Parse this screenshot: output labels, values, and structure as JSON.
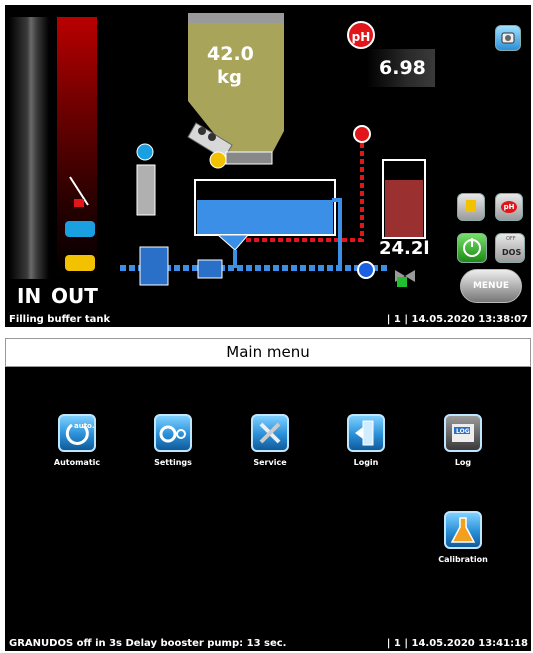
{
  "screen1": {
    "in_label": "IN",
    "out_label": "OUT",
    "hopper_value": "42.0",
    "hopper_unit": "kg",
    "ph_badge": "pH",
    "ph_value": "6.98",
    "tank_volume": "24.2l",
    "dos_button_label": "DOS",
    "dos_off_label": "OFF",
    "menu_button_label": "MENUE",
    "ph_button_label": "pH",
    "status": {
      "message": "Filling buffer tank",
      "right": "| 1 | 14.05.2020 13:38:07"
    }
  },
  "screen2": {
    "title": "Main menu",
    "items": [
      {
        "label": "Automatic",
        "icon": "auto-refresh-icon"
      },
      {
        "label": "Settings",
        "icon": "gears-icon"
      },
      {
        "label": "Service",
        "icon": "tools-icon"
      },
      {
        "label": "Login",
        "icon": "door-icon"
      },
      {
        "label": "Log",
        "icon": "log-book-icon"
      },
      {
        "label": "Calibration",
        "icon": "flask-icon"
      }
    ],
    "auto_icon_text": "auto.",
    "log_icon_text": "LOG",
    "status": {
      "message": "GRANUDOS off in 3s Delay booster pump: 13 sec.",
      "right": "| 1 | 14.05.2020 13:41:18"
    }
  },
  "colors": {
    "accent_blue": "#2a8fd8",
    "alarm_red": "#e0161a",
    "hopper_olive": "#a8a55a",
    "water_blue": "#3b8fe6",
    "pipe_red": "#e0161a"
  }
}
